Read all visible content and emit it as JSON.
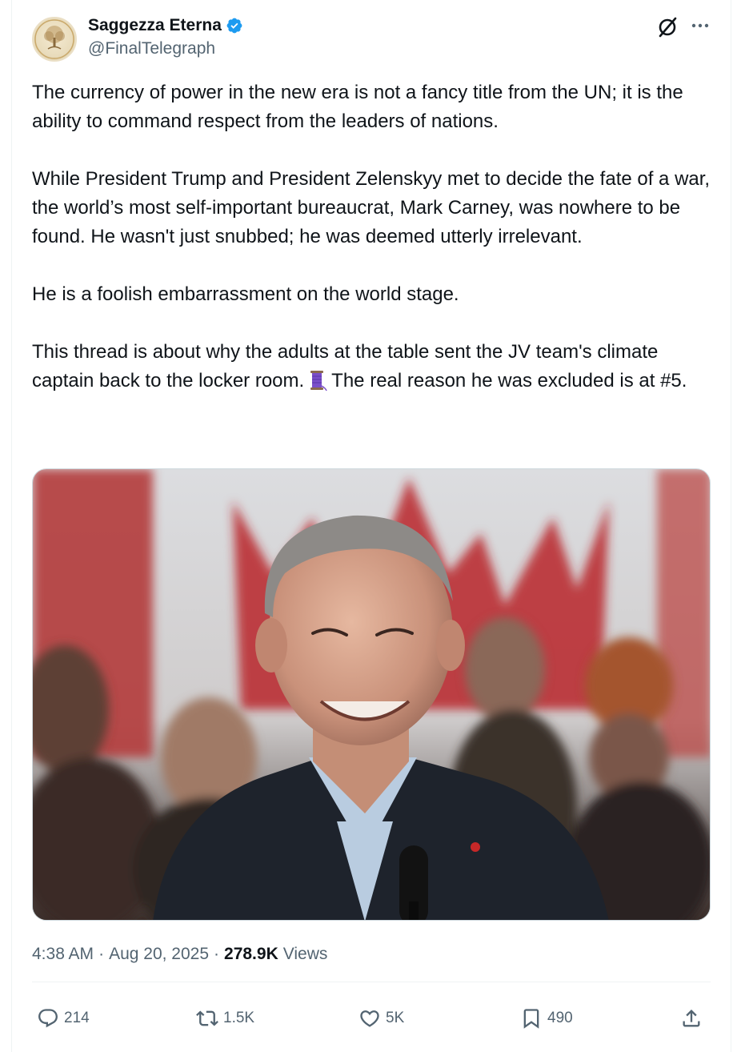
{
  "author": {
    "display_name": "Saggezza Eterna",
    "handle": "@FinalTelegraph",
    "verified": true,
    "avatar_icon": "tree-of-life-logo"
  },
  "header_icons": [
    "grok-icon",
    "more-options-icon"
  ],
  "tweet": {
    "paragraph_1": "The currency of power in the new era is not a fancy title from the UN; it is the ability to command respect from the leaders of nations.",
    "paragraph_2": "While President Trump and President Zelenskyy met to decide the fate of a war, the world’s most self-important bureaucrat, Mark Carney, was nowhere to be found. He wasn't just snubbed; he was deemed utterly irrelevant.",
    "paragraph_3": "He is a foolish embarrassment on the world stage.",
    "paragraph_4_before_emoji": "This thread is about why the adults at the table sent the JV team's climate captain back to the locker room.",
    "paragraph_4_emoji": "thread-spool-icon",
    "paragraph_4_after_emoji": "The real reason he was excluded is at #5."
  },
  "media": {
    "type": "photo",
    "icon": "photo-of-smiling-man-at-podium"
  },
  "meta": {
    "time": "4:38 AM",
    "separator": "·",
    "date": "Aug 20, 2025",
    "views_count": "278.9K",
    "views_label": "Views"
  },
  "actions": {
    "replies": "214",
    "reposts": "1.5K",
    "likes": "5K",
    "bookmarks": "490"
  },
  "colors": {
    "text_primary": "#0f1419",
    "text_secondary": "#536471",
    "verified_blue": "#1d9bf0",
    "border": "#eff3f4"
  }
}
